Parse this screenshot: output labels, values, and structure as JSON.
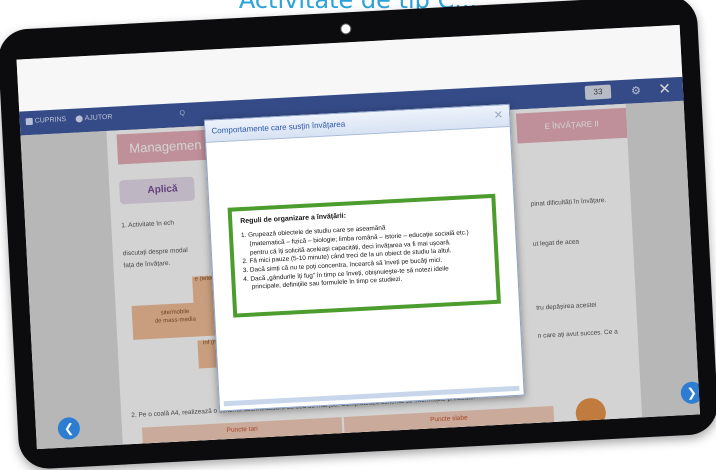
{
  "heading": "Activitate de tip C...",
  "toolbar": {
    "cuprins": "CUPRINS",
    "ajutor": "AJUTOR",
    "search": "Q",
    "page_number": "33",
    "close_icon": "close-icon"
  },
  "book": {
    "header_left": "Managemen",
    "header_right": "E ÎNVĂȚARE II",
    "aplica": "Aplică",
    "activity_line": "1.  Activitate în ech",
    "lines": [
      "discutați despre modal",
      "fața de învățare."
    ],
    "right_lines": [
      "pinat dificultăți în învățare.",
      "ut legat de acea",
      "tru depășirea acestei",
      "n care ați avut succes. Ce a"
    ],
    "box_media": "site/mobile\nde mass-media",
    "box_top": "e\n(teledu",
    "box_bottom": "inf\n(m",
    "exercise_2": "2. Pe o coală A4, realizează o schemă asemănătoare cu cea de mai jos. Completează schema cu informațiile precizate.",
    "col_strong": "Puncte tari",
    "col_weak": "Puncte slabe"
  },
  "modal": {
    "title": "Comportamente care susțin învățarea",
    "rules_title": "Reguli de organizare a învățării:",
    "rules": [
      "1. Grupează obiectele de studiu care se aseamănă",
      "(matematică – fizică – biologie; limba română – istorie – educație socială etc.)",
      "pentru că îți solicită aceleași capacități, deci învățarea va fi mai ușoară.",
      "2. Fă mici pauze (5-10 minute) când treci de la un obiect de studiu la altul.",
      "3. Dacă simți că nu te poți concentra, încearcă să înveți pe bucăți mici.",
      "4. Dacă „gândurile îți fug” în timp ce înveți, obișnuiește-te să notezi ideile",
      "principale, definițiile sau formulele în timp ce studiezi."
    ]
  },
  "colors": {
    "accent_blue": "#2c4a9a",
    "rules_border": "#4c9c2e",
    "heading": "#2aa3d8"
  }
}
